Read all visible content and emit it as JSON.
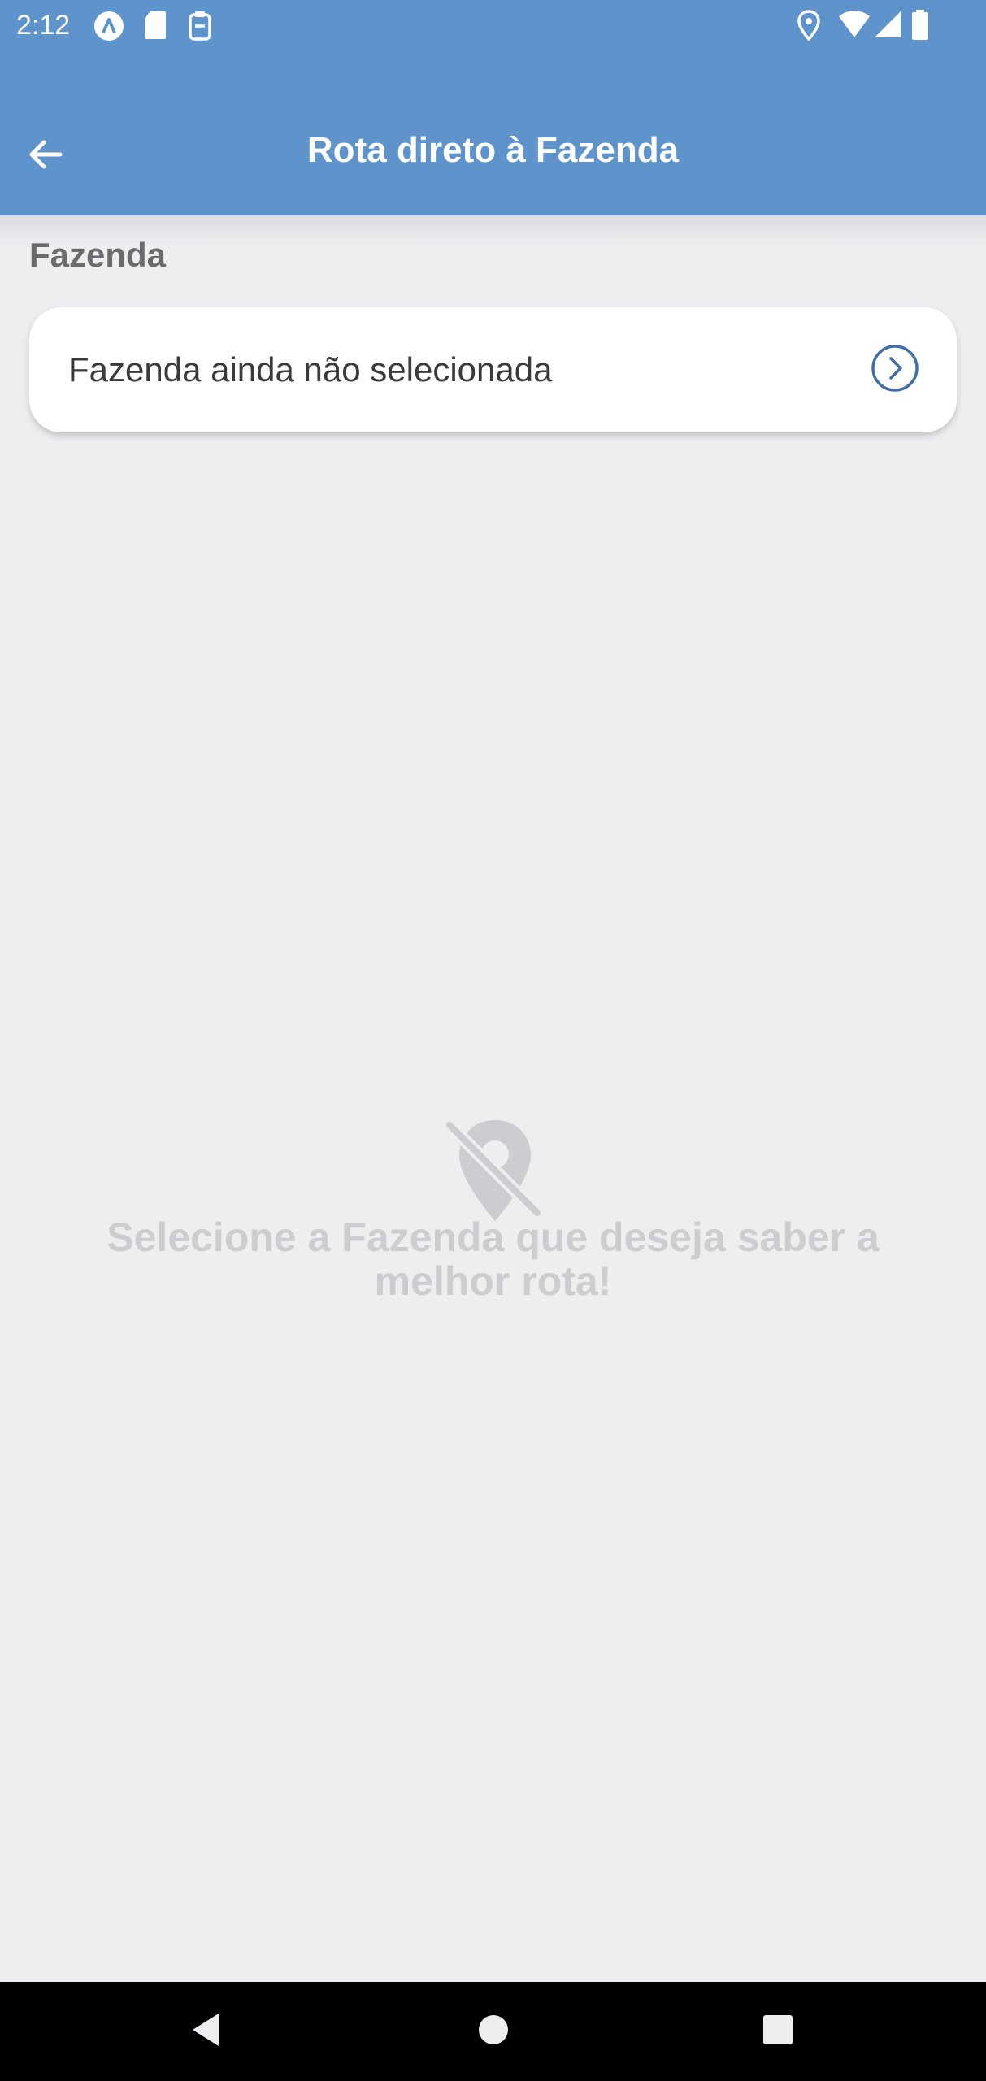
{
  "statusbar": {
    "time": "2:12",
    "left_icons": [
      "app-a-icon",
      "sd-card-icon",
      "clipboard-icon"
    ],
    "right_icons": [
      "location-pin-icon",
      "wifi-icon",
      "cell-signal-icon",
      "battery-icon"
    ]
  },
  "appbar": {
    "title": "Rota direto à Fazenda",
    "back_icon": "arrow-left-icon",
    "color": "#5e93cb"
  },
  "farm_section": {
    "label": "Fazenda",
    "selector_text": "Fazenda ainda não selecionada",
    "selector_icon": "chevron-right-circle-icon",
    "accent": "#3f6fa6"
  },
  "empty_state": {
    "icon": "location-off-icon",
    "message": "Selecione a Fazenda que deseja saber a melhor rota!"
  },
  "navbar": {
    "buttons": [
      "back-triangle-icon",
      "home-circle-icon",
      "recents-square-icon"
    ]
  }
}
